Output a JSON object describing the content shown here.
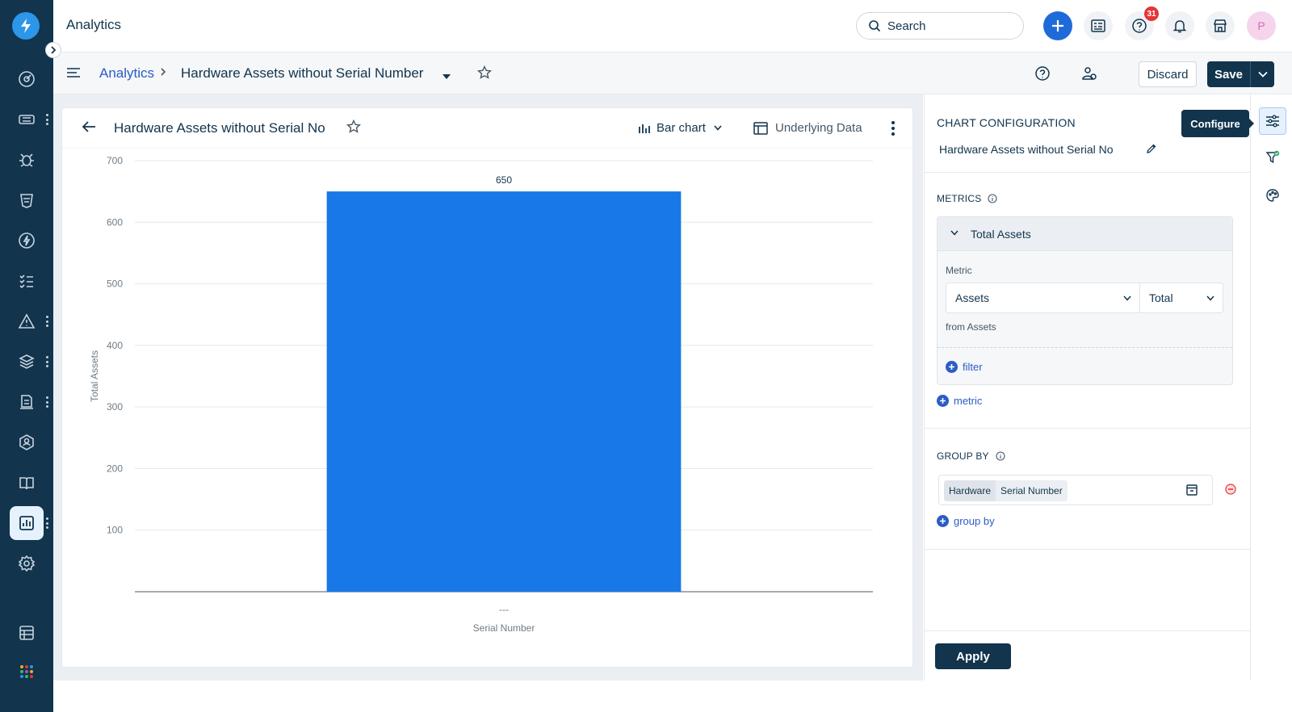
{
  "app": {
    "title": "Analytics"
  },
  "search": {
    "placeholder": "Search"
  },
  "topbar": {
    "help_badge": "31",
    "avatar_initial": "P"
  },
  "breadcrumb": {
    "parent": "Analytics",
    "current": "Hardware Assets without Serial Number"
  },
  "actions": {
    "discard": "Discard",
    "save": "Save"
  },
  "card": {
    "title": "Hardware Assets without Serial No",
    "chart_type": "Bar chart",
    "underlying": "Underlying Data"
  },
  "config": {
    "heading": "CHART CONFIGURATION",
    "name": "Hardware Assets without Serial No",
    "tooltip": "Configure",
    "metrics_label": "METRICS",
    "metric_name": "Total Assets",
    "metric_label": "Metric",
    "metric_field": "Assets",
    "metric_agg": "Total",
    "from_text": "from Assets",
    "add_filter": "filter",
    "add_metric": "metric",
    "groupby_label": "GROUP BY",
    "group_chip_entity": "Hardware",
    "group_chip_field": "Serial Number",
    "add_groupby": "group by",
    "apply": "Apply"
  },
  "chart_data": {
    "type": "bar",
    "categories": [
      "---"
    ],
    "values": [
      650
    ],
    "data_labels": [
      "650"
    ],
    "xlabel": "Serial Number",
    "ylabel": "Total Assets",
    "yticks": [
      100,
      200,
      300,
      400,
      500,
      600,
      700
    ],
    "ylim": [
      0,
      700
    ],
    "grid": true,
    "colors": {
      "bar": "#1878e8"
    }
  }
}
